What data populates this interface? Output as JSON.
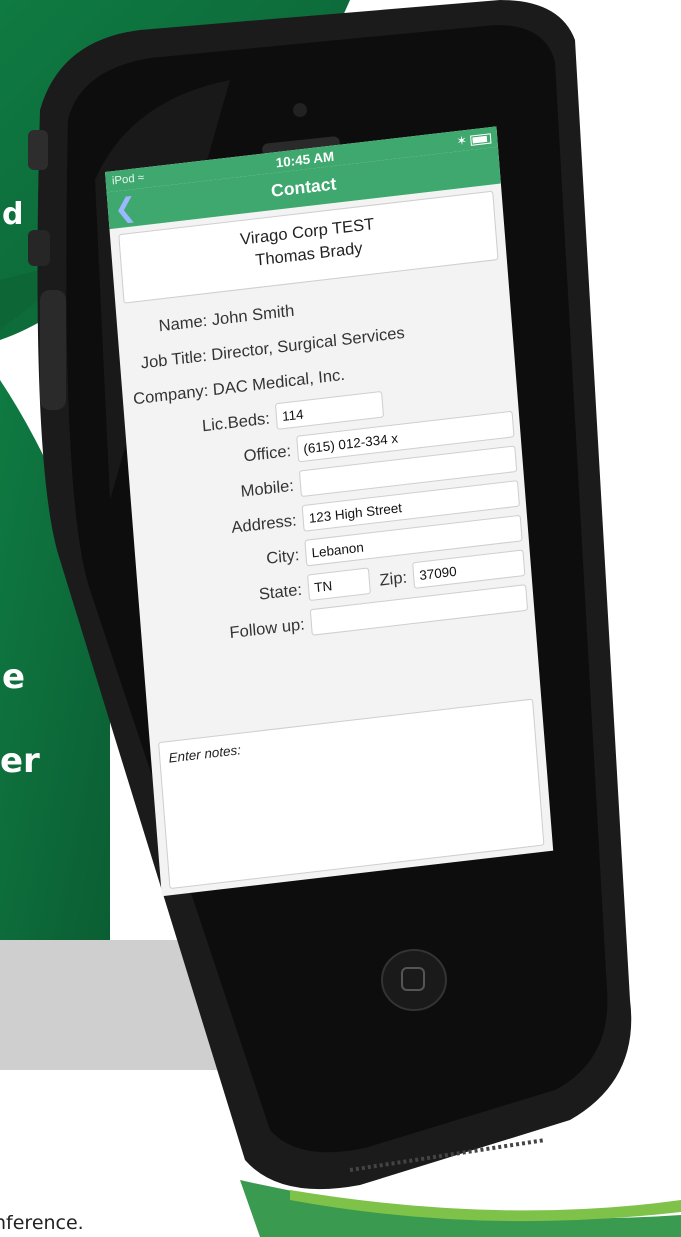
{
  "background": {
    "accent_color": "#0e6b3a",
    "side_lines": [
      "d",
      "e",
      "er"
    ],
    "footer_caption": "nference."
  },
  "status_bar": {
    "device": "iPod",
    "wifi_icon": "wifi-icon",
    "time": "10:45 AM",
    "bluetooth_icon": "bluetooth-icon",
    "battery_icon": "battery-icon"
  },
  "nav": {
    "back_icon": "chevron-left-icon",
    "title": "Contact"
  },
  "header_card": {
    "line1": "Virago Corp TEST",
    "line2": "Thomas Brady"
  },
  "contact": {
    "name": "Name: John Smith",
    "job_title": "Job Title: Director, Surgical Services",
    "company": "Company: DAC Medical, Inc."
  },
  "fields": {
    "lic_beds": {
      "label": "Lic.Beds:",
      "value": "114"
    },
    "office": {
      "label": "Office:",
      "value": "(615) 012-334 x"
    },
    "mobile": {
      "label": "Mobile:",
      "value": ""
    },
    "address": {
      "label": "Address:",
      "value": "123 High Street"
    },
    "city": {
      "label": "City:",
      "value": "Lebanon"
    },
    "state": {
      "label": "State:",
      "value": "TN"
    },
    "zip": {
      "label": "Zip:",
      "value": "37090"
    },
    "follow_up": {
      "label": "Follow up:",
      "value": ""
    }
  },
  "notes": {
    "placeholder": "Enter notes:"
  },
  "colors": {
    "header_green": "#3fa86e",
    "back_blue": "#9ab7ff",
    "device_body": "#1c1c1c"
  }
}
